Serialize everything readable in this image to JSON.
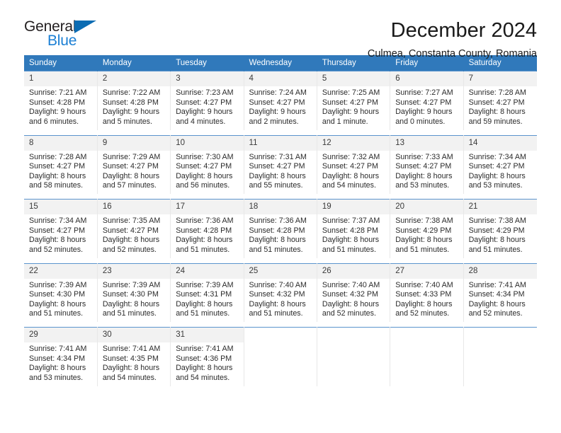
{
  "logo": {
    "word_one": "General",
    "word_two": "Blue",
    "triangle_icon": "blue-triangle-icon",
    "accent_color": "#0b6cb3",
    "blue_text_color": "#1b7fd4"
  },
  "header": {
    "title": "December 2024",
    "location": "Culmea, Constanta County, Romania"
  },
  "theme": {
    "header_blue": "#3079bb",
    "row_separator_blue": "#5b94cd",
    "daynum_band": "#f2f2f2"
  },
  "calendar": {
    "weekday_headers": [
      "Sunday",
      "Monday",
      "Tuesday",
      "Wednesday",
      "Thursday",
      "Friday",
      "Saturday"
    ],
    "labels": {
      "sunrise": "Sunrise:",
      "sunset": "Sunset:",
      "daylight": "Daylight:"
    },
    "weeks": [
      [
        {
          "day": "1",
          "sunrise": "Sunrise: 7:21 AM",
          "sunset": "Sunset: 4:28 PM",
          "daylight": "Daylight: 9 hours and 6 minutes."
        },
        {
          "day": "2",
          "sunrise": "Sunrise: 7:22 AM",
          "sunset": "Sunset: 4:28 PM",
          "daylight": "Daylight: 9 hours and 5 minutes."
        },
        {
          "day": "3",
          "sunrise": "Sunrise: 7:23 AM",
          "sunset": "Sunset: 4:27 PM",
          "daylight": "Daylight: 9 hours and 4 minutes."
        },
        {
          "day": "4",
          "sunrise": "Sunrise: 7:24 AM",
          "sunset": "Sunset: 4:27 PM",
          "daylight": "Daylight: 9 hours and 2 minutes."
        },
        {
          "day": "5",
          "sunrise": "Sunrise: 7:25 AM",
          "sunset": "Sunset: 4:27 PM",
          "daylight": "Daylight: 9 hours and 1 minute."
        },
        {
          "day": "6",
          "sunrise": "Sunrise: 7:27 AM",
          "sunset": "Sunset: 4:27 PM",
          "daylight": "Daylight: 9 hours and 0 minutes."
        },
        {
          "day": "7",
          "sunrise": "Sunrise: 7:28 AM",
          "sunset": "Sunset: 4:27 PM",
          "daylight": "Daylight: 8 hours and 59 minutes."
        }
      ],
      [
        {
          "day": "8",
          "sunrise": "Sunrise: 7:28 AM",
          "sunset": "Sunset: 4:27 PM",
          "daylight": "Daylight: 8 hours and 58 minutes."
        },
        {
          "day": "9",
          "sunrise": "Sunrise: 7:29 AM",
          "sunset": "Sunset: 4:27 PM",
          "daylight": "Daylight: 8 hours and 57 minutes."
        },
        {
          "day": "10",
          "sunrise": "Sunrise: 7:30 AM",
          "sunset": "Sunset: 4:27 PM",
          "daylight": "Daylight: 8 hours and 56 minutes."
        },
        {
          "day": "11",
          "sunrise": "Sunrise: 7:31 AM",
          "sunset": "Sunset: 4:27 PM",
          "daylight": "Daylight: 8 hours and 55 minutes."
        },
        {
          "day": "12",
          "sunrise": "Sunrise: 7:32 AM",
          "sunset": "Sunset: 4:27 PM",
          "daylight": "Daylight: 8 hours and 54 minutes."
        },
        {
          "day": "13",
          "sunrise": "Sunrise: 7:33 AM",
          "sunset": "Sunset: 4:27 PM",
          "daylight": "Daylight: 8 hours and 53 minutes."
        },
        {
          "day": "14",
          "sunrise": "Sunrise: 7:34 AM",
          "sunset": "Sunset: 4:27 PM",
          "daylight": "Daylight: 8 hours and 53 minutes."
        }
      ],
      [
        {
          "day": "15",
          "sunrise": "Sunrise: 7:34 AM",
          "sunset": "Sunset: 4:27 PM",
          "daylight": "Daylight: 8 hours and 52 minutes."
        },
        {
          "day": "16",
          "sunrise": "Sunrise: 7:35 AM",
          "sunset": "Sunset: 4:27 PM",
          "daylight": "Daylight: 8 hours and 52 minutes."
        },
        {
          "day": "17",
          "sunrise": "Sunrise: 7:36 AM",
          "sunset": "Sunset: 4:28 PM",
          "daylight": "Daylight: 8 hours and 51 minutes."
        },
        {
          "day": "18",
          "sunrise": "Sunrise: 7:36 AM",
          "sunset": "Sunset: 4:28 PM",
          "daylight": "Daylight: 8 hours and 51 minutes."
        },
        {
          "day": "19",
          "sunrise": "Sunrise: 7:37 AM",
          "sunset": "Sunset: 4:28 PM",
          "daylight": "Daylight: 8 hours and 51 minutes."
        },
        {
          "day": "20",
          "sunrise": "Sunrise: 7:38 AM",
          "sunset": "Sunset: 4:29 PM",
          "daylight": "Daylight: 8 hours and 51 minutes."
        },
        {
          "day": "21",
          "sunrise": "Sunrise: 7:38 AM",
          "sunset": "Sunset: 4:29 PM",
          "daylight": "Daylight: 8 hours and 51 minutes."
        }
      ],
      [
        {
          "day": "22",
          "sunrise": "Sunrise: 7:39 AM",
          "sunset": "Sunset: 4:30 PM",
          "daylight": "Daylight: 8 hours and 51 minutes."
        },
        {
          "day": "23",
          "sunrise": "Sunrise: 7:39 AM",
          "sunset": "Sunset: 4:30 PM",
          "daylight": "Daylight: 8 hours and 51 minutes."
        },
        {
          "day": "24",
          "sunrise": "Sunrise: 7:39 AM",
          "sunset": "Sunset: 4:31 PM",
          "daylight": "Daylight: 8 hours and 51 minutes."
        },
        {
          "day": "25",
          "sunrise": "Sunrise: 7:40 AM",
          "sunset": "Sunset: 4:32 PM",
          "daylight": "Daylight: 8 hours and 51 minutes."
        },
        {
          "day": "26",
          "sunrise": "Sunrise: 7:40 AM",
          "sunset": "Sunset: 4:32 PM",
          "daylight": "Daylight: 8 hours and 52 minutes."
        },
        {
          "day": "27",
          "sunrise": "Sunrise: 7:40 AM",
          "sunset": "Sunset: 4:33 PM",
          "daylight": "Daylight: 8 hours and 52 minutes."
        },
        {
          "day": "28",
          "sunrise": "Sunrise: 7:41 AM",
          "sunset": "Sunset: 4:34 PM",
          "daylight": "Daylight: 8 hours and 52 minutes."
        }
      ],
      [
        {
          "day": "29",
          "sunrise": "Sunrise: 7:41 AM",
          "sunset": "Sunset: 4:34 PM",
          "daylight": "Daylight: 8 hours and 53 minutes."
        },
        {
          "day": "30",
          "sunrise": "Sunrise: 7:41 AM",
          "sunset": "Sunset: 4:35 PM",
          "daylight": "Daylight: 8 hours and 54 minutes."
        },
        {
          "day": "31",
          "sunrise": "Sunrise: 7:41 AM",
          "sunset": "Sunset: 4:36 PM",
          "daylight": "Daylight: 8 hours and 54 minutes."
        },
        {
          "day": "",
          "sunrise": "",
          "sunset": "",
          "daylight": ""
        },
        {
          "day": "",
          "sunrise": "",
          "sunset": "",
          "daylight": ""
        },
        {
          "day": "",
          "sunrise": "",
          "sunset": "",
          "daylight": ""
        },
        {
          "day": "",
          "sunrise": "",
          "sunset": "",
          "daylight": ""
        }
      ]
    ]
  }
}
